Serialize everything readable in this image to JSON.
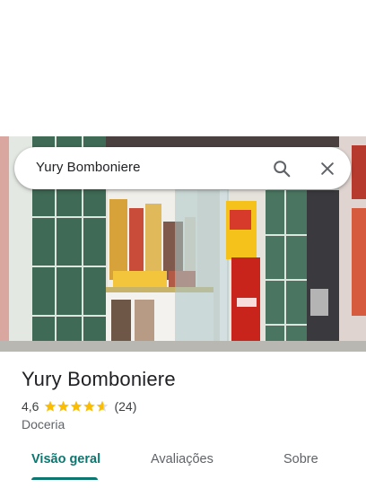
{
  "search": {
    "query": "Yury Bomboniere",
    "search_icon": "search-icon",
    "close_icon": "close-icon"
  },
  "place": {
    "name": "Yury Bomboniere",
    "rating": "4,6",
    "rating_stars": 4.6,
    "review_count": "(24)",
    "category": "Doceria"
  },
  "tabs": [
    {
      "label": "Visão geral",
      "active": true
    },
    {
      "label": "Avaliações",
      "active": false
    },
    {
      "label": "Sobre",
      "active": false
    }
  ],
  "colors": {
    "accent": "#0b7770",
    "star": "#fbbc04",
    "text_primary": "#202124",
    "text_secondary": "#5f6368"
  }
}
